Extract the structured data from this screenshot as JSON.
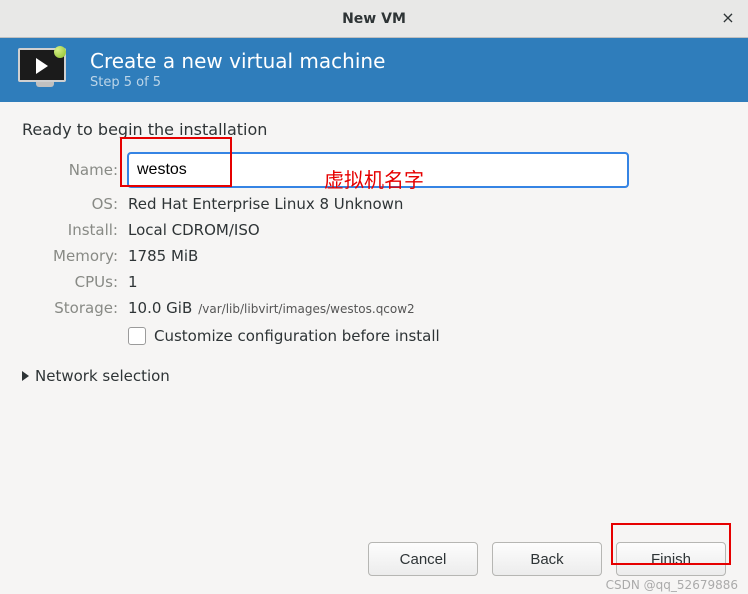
{
  "window": {
    "title": "New VM",
    "close_glyph": "×"
  },
  "header": {
    "title": "Create a new virtual machine",
    "step": "Step 5 of 5"
  },
  "content": {
    "ready_text": "Ready to begin the installation",
    "labels": {
      "name": "Name:",
      "os": "OS:",
      "install": "Install:",
      "memory": "Memory:",
      "cpus": "CPUs:",
      "storage": "Storage:"
    },
    "values": {
      "name_input": "westos",
      "os": "Red Hat Enterprise Linux 8 Unknown",
      "install": "Local CDROM/ISO",
      "memory": "1785 MiB",
      "cpus": "1",
      "storage_size": "10.0 GiB",
      "storage_path": "/var/lib/libvirt/images/westos.qcow2"
    },
    "customize_label": "Customize configuration before install",
    "customize_checked": false,
    "network_expander": "Network selection"
  },
  "buttons": {
    "cancel": "Cancel",
    "back": "Back",
    "finish": "Finish"
  },
  "annotations": {
    "name_hint": "虚拟机名字",
    "watermark": "CSDN @qq_52679886"
  }
}
